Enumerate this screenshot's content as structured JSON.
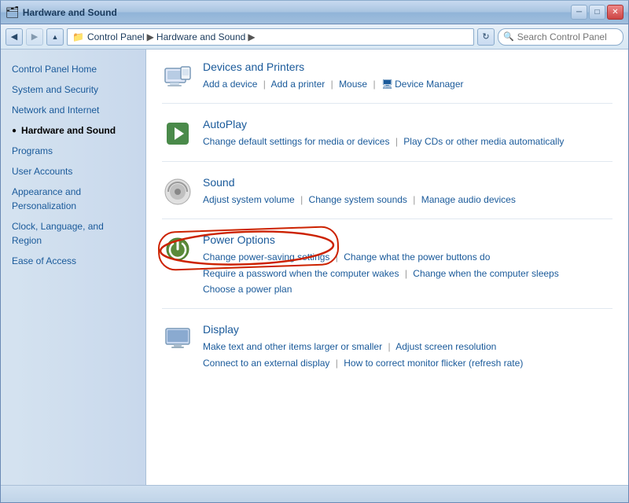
{
  "titlebar": {
    "title": "Hardware and Sound",
    "btn_minimize": "─",
    "btn_maximize": "□",
    "btn_close": "✕"
  },
  "addressbar": {
    "path_root": "Control Panel",
    "path_current": "Hardware and Sound",
    "search_placeholder": "Search Control Panel"
  },
  "sidebar": {
    "items": [
      {
        "id": "control-panel-home",
        "label": "Control Panel Home",
        "active": false,
        "bullet": false
      },
      {
        "id": "system-and-security",
        "label": "System and Security",
        "active": false,
        "bullet": false
      },
      {
        "id": "network-and-internet",
        "label": "Network and Internet",
        "active": false,
        "bullet": false
      },
      {
        "id": "hardware-and-sound",
        "label": "Hardware and Sound",
        "active": true,
        "bullet": true
      },
      {
        "id": "programs",
        "label": "Programs",
        "active": false,
        "bullet": false
      },
      {
        "id": "user-accounts",
        "label": "User Accounts",
        "active": false,
        "bullet": false
      },
      {
        "id": "appearance-and-personalization",
        "label": "Appearance and Personalization",
        "active": false,
        "bullet": false
      },
      {
        "id": "clock-language-region",
        "label": "Clock, Language, and Region",
        "active": false,
        "bullet": false
      },
      {
        "id": "ease-of-access",
        "label": "Ease of Access",
        "active": false,
        "bullet": false
      }
    ]
  },
  "sections": [
    {
      "id": "devices-and-printers",
      "title": "Devices and Printers",
      "icon": "🖨",
      "links": [
        {
          "label": "Add a device"
        },
        {
          "label": "Add a printer"
        },
        {
          "label": "Mouse"
        },
        {
          "label": "Device Manager"
        }
      ]
    },
    {
      "id": "autoplay",
      "title": "AutoPlay",
      "icon": "▶",
      "links": [
        {
          "label": "Change default settings for media or devices"
        },
        {
          "label": "Play CDs or other media automatically"
        }
      ]
    },
    {
      "id": "sound",
      "title": "Sound",
      "icon": "🔊",
      "links": [
        {
          "label": "Adjust system volume"
        },
        {
          "label": "Change system sounds"
        },
        {
          "label": "Manage audio devices"
        }
      ]
    },
    {
      "id": "power-options",
      "title": "Power Options",
      "icon": "⚡",
      "highlighted": true,
      "links_row1": [
        {
          "label": "Change power-saving settings"
        },
        {
          "label": "Change what the power buttons do"
        }
      ],
      "links_row2": [
        {
          "label": "Require a password when the computer wakes"
        },
        {
          "label": "Change when the computer sleeps"
        }
      ],
      "links_row3": [
        {
          "label": "Choose a power plan"
        }
      ]
    },
    {
      "id": "display",
      "title": "Display",
      "icon": "🖥",
      "links_row1": [
        {
          "label": "Make text and other items larger or smaller"
        },
        {
          "label": "Adjust screen resolution"
        }
      ],
      "links_row2": [
        {
          "label": "Connect to an external display"
        },
        {
          "label": "How to correct monitor flicker (refresh rate)"
        }
      ]
    }
  ]
}
